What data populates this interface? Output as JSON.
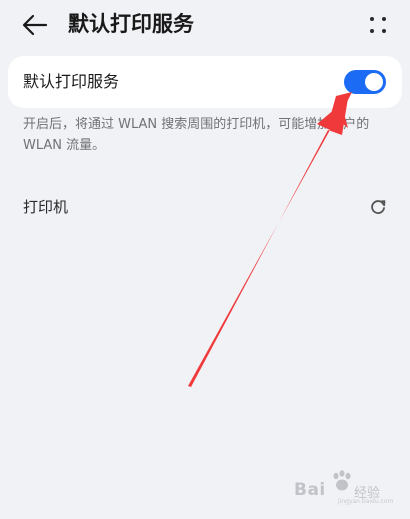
{
  "header": {
    "title": "默认打印服务",
    "back_icon": "arrow-left-icon",
    "more_icon": "more-dots-icon"
  },
  "service_card": {
    "label": "默认打印服务",
    "toggle_on": true,
    "accent_color": "#1b6bf5"
  },
  "description": "开启后，将通过 WLAN 搜索周围的打印机，可能增加用户的 WLAN 流量。",
  "printers": {
    "label": "打印机",
    "refresh_icon": "refresh-icon"
  },
  "annotation": {
    "arrow_color": "#f0393b"
  },
  "watermark": {
    "text_left": "Bai",
    "text_right": "经验",
    "url": "jingyan.baidu.com"
  }
}
